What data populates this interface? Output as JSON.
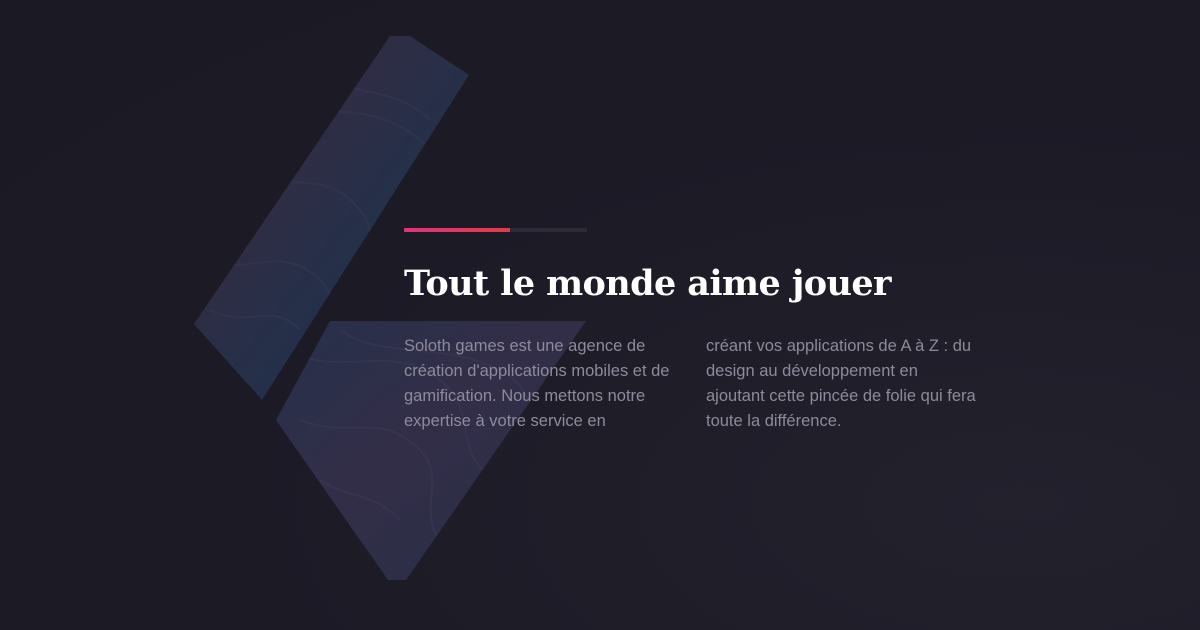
{
  "accent": {
    "gradient_start": "#e0337d",
    "gradient_end": "#e23a46",
    "track_color": "#2c2b36",
    "progress": 0.58
  },
  "colors": {
    "background": "#1c1a25",
    "heading": "#ffffff",
    "body_text": "#8d8b9b",
    "logo_fill": "#2a2f42"
  },
  "logo": {
    "icon": "soloth-logo-icon"
  },
  "section": {
    "title": "Tout le monde aime jouer",
    "paragraph_column_1": "Soloth games est une agence de création d'applications mobiles et de gamification. Nous mettons notre expertise à votre service en",
    "paragraph_column_2": "créant vos applications de A à Z : du design au développement en ajoutant cette pincée de folie qui fera toute la différence."
  }
}
